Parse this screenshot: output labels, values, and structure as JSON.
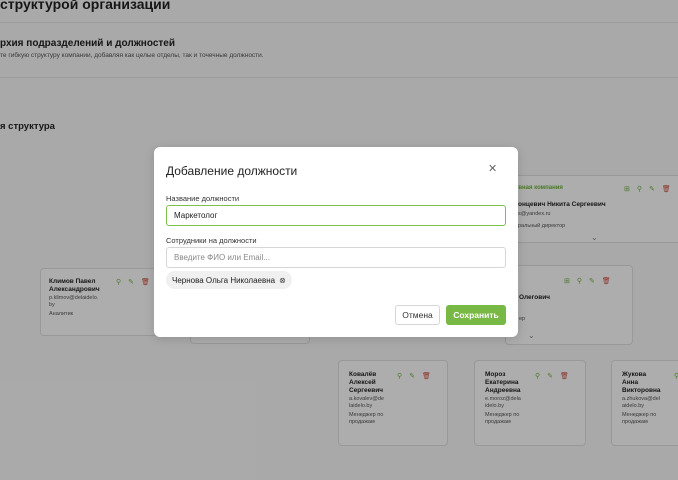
{
  "page": {
    "title": "структурой организации",
    "hierarchy_title": "рхия подразделений и должностей",
    "hierarchy_sub": "те гибкую структуру компании, добавляя как целые отделы, так и точечные должности.",
    "structure_title": "я структура"
  },
  "org": {
    "root": {
      "header": "евная компания",
      "name": "онцевич Никита Сергеевич",
      "email": "s@yandex.ru",
      "role": "ральный директор"
    },
    "mid": {
      "name": "Олегович",
      "role": "ер"
    },
    "left": {
      "name_line1": "Климов Павел",
      "name_line2": "Александрович",
      "email_line1": "p.klimov@delaidelo.",
      "email_line2": "by",
      "role": "Аналитик"
    },
    "cards": [
      {
        "n1": "Ковалёв",
        "n2": "Алексей",
        "n3": "Сергеевич",
        "e1": "a.kovalev@de",
        "e2": "laidelo.by",
        "r1": "Менеджер по",
        "r2": "продажам"
      },
      {
        "n1": "Мороз",
        "n2": "Екатерина",
        "n3": "Андреевна",
        "e1": "e.moroz@dela",
        "e2": "idelo.by",
        "r1": "Менеджер по",
        "r2": "продажам"
      },
      {
        "n1": "Жукова",
        "n2": "Анна",
        "n3": "Викторовна",
        "e1": "a.zhukova@del",
        "e2": "aidelo.by",
        "r1": "Менеджер по",
        "r2": "продажам"
      }
    ]
  },
  "modal": {
    "title": "Добавление должности",
    "position_label": "Название должности",
    "position_value": "Маркетолог",
    "employees_label": "Сотрудники на должности",
    "employees_placeholder": "Введите ФИО или Email...",
    "chip_name": "Чернова Ольга Николаевна",
    "cancel_label": "Отмена",
    "save_label": "Сохранить"
  },
  "icons": {
    "add_user": "add-user-icon",
    "edit": "pencil-icon",
    "delete": "trash-icon",
    "close": "close-icon",
    "chevron": "chevron-down-icon"
  },
  "colors": {
    "accent": "#78b845",
    "danger": "#d24b3f"
  }
}
